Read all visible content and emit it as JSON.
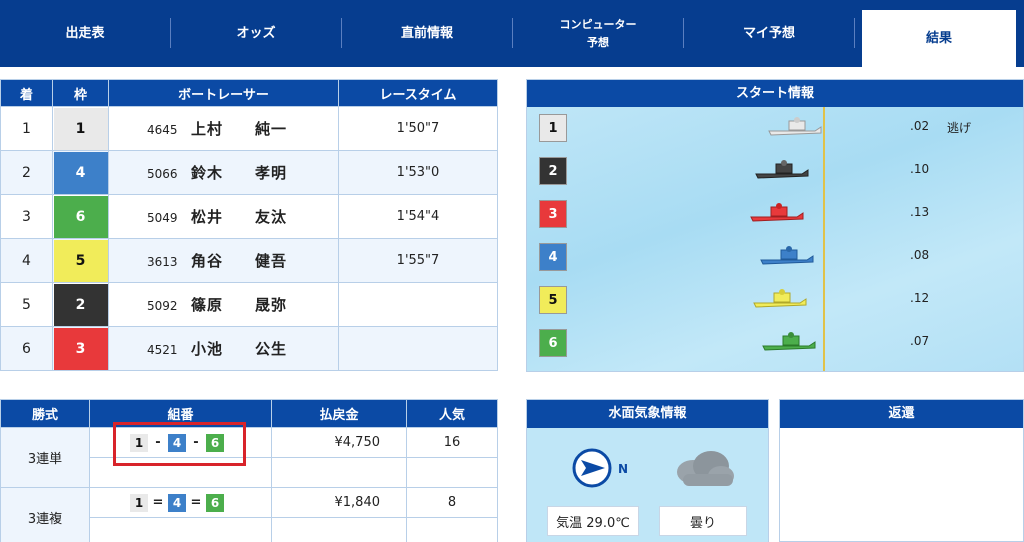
{
  "nav": {
    "tabs": [
      {
        "label": "出走表"
      },
      {
        "label": "オッズ"
      },
      {
        "label": "直前情報"
      },
      {
        "label": "コンピューター",
        "sub": "予想"
      },
      {
        "label": "マイ予想"
      },
      {
        "label": "結果"
      }
    ],
    "active": "結果"
  },
  "results": {
    "headers": [
      "着",
      "枠",
      "ボートレーサー",
      "レースタイム"
    ],
    "rows": [
      {
        "rank": "1",
        "waku": "1",
        "number": "4645",
        "name": "上村　　純一",
        "time": "1'50\"7"
      },
      {
        "rank": "2",
        "waku": "4",
        "number": "5066",
        "name": "鈴木　　孝明",
        "time": "1'53\"0"
      },
      {
        "rank": "3",
        "waku": "6",
        "number": "5049",
        "name": "松井　　友汰",
        "time": "1'54\"4"
      },
      {
        "rank": "4",
        "waku": "5",
        "number": "3613",
        "name": "角谷　　健吾",
        "time": "1'55\"7"
      },
      {
        "rank": "5",
        "waku": "2",
        "number": "5092",
        "name": "篠原　　晟弥",
        "time": ""
      },
      {
        "rank": "6",
        "waku": "3",
        "number": "4521",
        "name": "小池　　公生",
        "time": ""
      }
    ]
  },
  "start_info": {
    "title": "スタート情報",
    "rows": [
      {
        "lane": "1",
        "st": ".02",
        "label": "逃げ"
      },
      {
        "lane": "2",
        "st": ".10",
        "label": ""
      },
      {
        "lane": "3",
        "st": ".13",
        "label": ""
      },
      {
        "lane": "4",
        "st": ".08",
        "label": ""
      },
      {
        "lane": "5",
        "st": ".12",
        "label": ""
      },
      {
        "lane": "6",
        "st": ".07",
        "label": ""
      }
    ]
  },
  "payout": {
    "headers": [
      "勝式",
      "組番",
      "払戻金",
      "人気"
    ],
    "rows": [
      {
        "kind": "3連単",
        "combo": [
          "1",
          "4",
          "6"
        ],
        "sep": "-",
        "amount": "¥4,750",
        "popularity": "16"
      },
      {
        "kind": "3連複",
        "combo": [
          "1",
          "4",
          "6"
        ],
        "sep": "=",
        "amount": "¥1,840",
        "popularity": "8"
      }
    ]
  },
  "weather": {
    "title": "水面気象情報",
    "wind_dir": "N",
    "temp": "気温 29.0℃",
    "condition": "曇り"
  },
  "henkan": {
    "title": "返還"
  },
  "colors": {
    "waku1": "#e9e9e9",
    "waku2": "#333333",
    "waku3": "#e8393b",
    "waku4": "#3d80c9",
    "waku5": "#f1ec5a",
    "waku6": "#4cae4c",
    "nav": "#063d8f",
    "header": "#0b4aa5",
    "highlight": "#d8232a"
  }
}
